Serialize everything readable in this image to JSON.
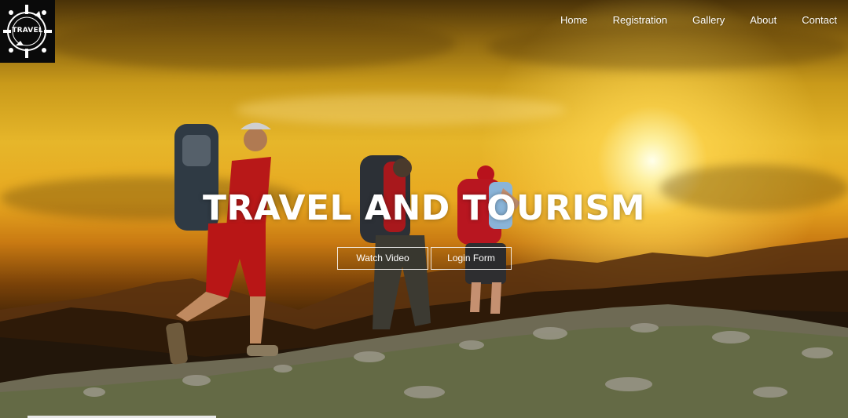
{
  "logo": {
    "text": "TRAVEL"
  },
  "nav": {
    "items": [
      {
        "label": "Home"
      },
      {
        "label": "Registration"
      },
      {
        "label": "Gallery"
      },
      {
        "label": "About"
      },
      {
        "label": "Contact"
      }
    ]
  },
  "hero": {
    "title": "TRAVEL AND TOURISM",
    "image_subject": "hikers-at-sunset-icon"
  },
  "buttons": {
    "watch_video": "Watch Video",
    "login_form": "Login Form"
  },
  "colors": {
    "sky_gold": "#e6b62a",
    "sun": "#fff5aa",
    "text": "#ffffff",
    "logo_bg": "#0a0a0a"
  }
}
